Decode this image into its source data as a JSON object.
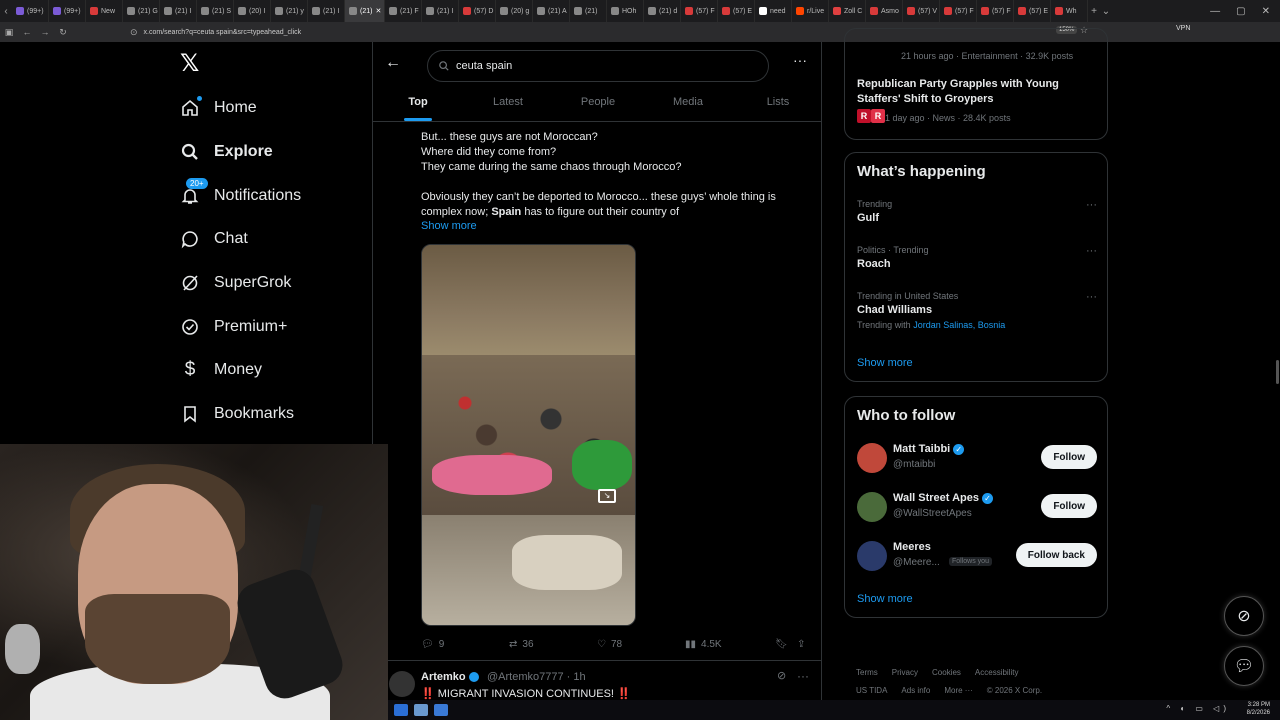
{
  "browser": {
    "tabs": [
      {
        "label": "(99+)",
        "color": "#7b5bd6"
      },
      {
        "label": "(99+)",
        "color": "#7b5bd6"
      },
      {
        "label": "New",
        "color": "#d83a3a"
      },
      {
        "label": "(21) G",
        "color": "#888"
      },
      {
        "label": "(21) I",
        "color": "#888"
      },
      {
        "label": "(21) S",
        "color": "#888"
      },
      {
        "label": "(20) I",
        "color": "#888"
      },
      {
        "label": "(21) y",
        "color": "#888"
      },
      {
        "label": "(21) I",
        "color": "#888"
      },
      {
        "label": "(21)",
        "color": "#888",
        "active": true
      },
      {
        "label": "(21) F",
        "color": "#888"
      },
      {
        "label": "(21) I",
        "color": "#888"
      },
      {
        "label": "(57) D",
        "color": "#d83a3a"
      },
      {
        "label": "(20) g",
        "color": "#888"
      },
      {
        "label": "(21) A",
        "color": "#888"
      },
      {
        "label": "(21)",
        "color": "#888"
      },
      {
        "label": "HOh",
        "color": "#888"
      },
      {
        "label": "(21) d",
        "color": "#888"
      },
      {
        "label": "(57) F",
        "color": "#d83a3a"
      },
      {
        "label": "(57) E",
        "color": "#d83a3a"
      },
      {
        "label": "need",
        "color": "#fff"
      },
      {
        "label": "r/Live",
        "color": "#ff4500"
      },
      {
        "label": "Zoll C",
        "color": "#e04040"
      },
      {
        "label": "Asmo",
        "color": "#d83a3a"
      },
      {
        "label": "(57) V",
        "color": "#d83a3a"
      },
      {
        "label": "(57) F",
        "color": "#d83a3a"
      },
      {
        "label": "(57) F",
        "color": "#d83a3a"
      },
      {
        "label": "(57) E",
        "color": "#d83a3a"
      },
      {
        "label": "Wh",
        "color": "#d83a3a"
      }
    ],
    "url": "x.com/search?q=ceuta spain&src=typeahead_click",
    "zoom": "150%",
    "vpn": "VPN"
  },
  "nav": {
    "items": [
      {
        "label": "Home",
        "icon": "home-icon"
      },
      {
        "label": "Explore",
        "icon": "search-icon"
      },
      {
        "label": "Notifications",
        "icon": "bell-icon",
        "badge": "20+"
      },
      {
        "label": "Chat",
        "icon": "chat-icon"
      },
      {
        "label": "SuperGrok",
        "icon": "grok-icon"
      },
      {
        "label": "Premium+",
        "icon": "premium-icon"
      },
      {
        "label": "Money",
        "icon": "money-icon"
      },
      {
        "label": "Bookmarks",
        "icon": "bookmark-icon"
      }
    ]
  },
  "search": {
    "value": "ceuta spain",
    "tabs": [
      "Top",
      "Latest",
      "People",
      "Media",
      "Lists"
    ]
  },
  "tweet": {
    "lines": [
      "But... these guys are not Moroccan?",
      "Where did they come from?",
      "They came during the same chaos through Morocco?"
    ],
    "para2_pre": "Obviously they can’t be deported to Morocco... these guys’ whole thing is complex now; ",
    "para2_bold": "Spain",
    "para2_post": " has to figure out their country of",
    "show_more": "Show more",
    "replies": "9",
    "reposts": "36",
    "likes": "78",
    "views": "4.5K"
  },
  "next_tweet": {
    "name": "Artemko",
    "handle": "@Artemko7777 · 1h",
    "text": "‼️ MIGRANT INVASION CONTINUES! ‼️"
  },
  "news": {
    "prev_meta": "21 hours ago · Entertainment · 32.9K posts",
    "title": "Republican Party Grapples with Young Staffers' Shift to Groypers",
    "meta": "1 day ago · News · 28.4K posts"
  },
  "happening": {
    "title": "What’s happening",
    "trends": [
      {
        "context": "Trending",
        "name": "Gulf"
      },
      {
        "context": "Politics · Trending",
        "name": "Roach"
      },
      {
        "context": "Trending in United States",
        "name": "Chad Williams",
        "with_label": "Trending with ",
        "with_names": "Jordan Salinas, Bosnia"
      }
    ],
    "show_more": "Show more"
  },
  "who_to_follow": {
    "title": "Who to follow",
    "accounts": [
      {
        "name": "Matt Taibbi",
        "handle": "@mtaibbi",
        "button": "Follow",
        "verified": true,
        "avatar": "#c0483a"
      },
      {
        "name": "Wall Street Apes",
        "handle": "@WallStreetApes",
        "button": "Follow",
        "verified": true,
        "avatar": "#4a6a3a"
      },
      {
        "name": "Meeres",
        "handle": "@Meere...",
        "follows_you": "Follows you",
        "button": "Follow back",
        "verified": false,
        "avatar": "#2a3a6a"
      }
    ],
    "show_more": "Show more"
  },
  "footer": {
    "links": [
      "Terms",
      "Privacy",
      "Cookies",
      "Accessibility",
      "US TIDA",
      "Ads info",
      "More ···",
      "© 2026 X Corp."
    ]
  },
  "taskbar": {
    "time": "3:28 PM",
    "date": "8/2/2026"
  }
}
